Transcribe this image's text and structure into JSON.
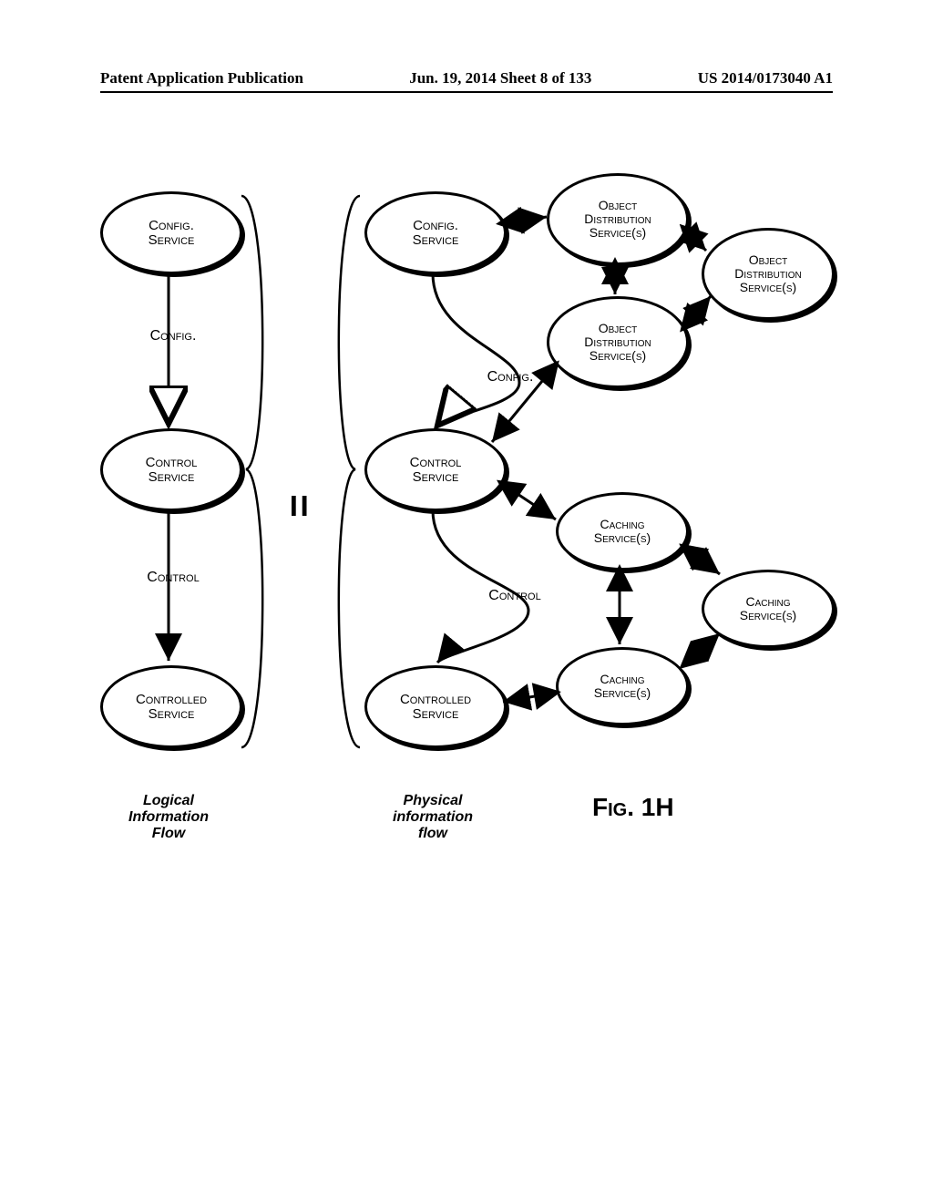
{
  "header": {
    "left": "Patent Application Publication",
    "center": "Jun. 19, 2014  Sheet 8 of 133",
    "right": "US 2014/0173040 A1"
  },
  "nodes": {
    "logical": {
      "config": {
        "l1": "Config.",
        "l2": "Service"
      },
      "control": {
        "l1": "Control",
        "l2": "Service"
      },
      "controlled": {
        "l1": "Controlled",
        "l2": "Service"
      }
    },
    "physical": {
      "config": {
        "l1": "Config.",
        "l2": "Service"
      },
      "control": {
        "l1": "Control",
        "l2": "Service"
      },
      "controlled": {
        "l1": "Controlled",
        "l2": "Service"
      },
      "od_top": {
        "l1": "Object",
        "l2": "Distribution",
        "l3": "Service(s)"
      },
      "od_mid": {
        "l1": "Object",
        "l2": "Distribution",
        "l3": "Service(s)"
      },
      "od_right": {
        "l1": "Object",
        "l2": "Distribution",
        "l3": "Service(s)"
      },
      "cache_top": {
        "l1": "Caching",
        "l2": "Service(s)"
      },
      "cache_bot": {
        "l1": "Caching",
        "l2": "Service(s)"
      },
      "cache_right": {
        "l1": "Caching",
        "l2": "Service(s)"
      }
    }
  },
  "labels": {
    "config_l": "Config.",
    "control_l": "Control",
    "config_p": "Config.",
    "control_p": "Control"
  },
  "captions": {
    "logical": "Logical\nInformation\nFlow",
    "physical": "Physical\ninformation\nflow"
  },
  "equals": "=",
  "figure_label": "Fig. 1H",
  "chart_data": {
    "type": "diagram",
    "title": "FIG. 1H — Logical vs. Physical information flow",
    "sides": [
      {
        "name": "Logical Information Flow",
        "nodes": [
          "Config. Service",
          "Control Service",
          "Controlled Service"
        ],
        "edges": [
          {
            "from": "Config. Service",
            "to": "Control Service",
            "label": "Config.",
            "style": "hollow-arrow"
          },
          {
            "from": "Control Service",
            "to": "Controlled Service",
            "label": "Control",
            "style": "solid-arrow"
          }
        ]
      },
      {
        "name": "Physical information flow",
        "nodes": [
          "Config. Service",
          "Control Service",
          "Controlled Service",
          "Object Distribution Service(s) (top)",
          "Object Distribution Service(s) (mid)",
          "Object Distribution Service(s) (right)",
          "Caching Service(s) (top)",
          "Caching Service(s) (bottom)",
          "Caching Service(s) (right)"
        ],
        "edges": [
          {
            "from": "Config. Service",
            "to": "Control Service",
            "label": "Config.",
            "via": "Object Distribution / Caching cluster",
            "style": "hollow-arrow, curved"
          },
          {
            "from": "Control Service",
            "to": "Controlled Service",
            "label": "Control",
            "via": "Object Distribution / Caching cluster",
            "style": "solid-arrow, curved"
          },
          {
            "from": "Config. Service",
            "to": "Object Distribution Service(s) (top)",
            "style": "double-arrow"
          },
          {
            "from": "Object Distribution Service(s) (top)",
            "to": "Object Distribution Service(s) (mid)",
            "style": "double-arrow"
          },
          {
            "from": "Object Distribution Service(s) (top)",
            "to": "Object Distribution Service(s) (right)",
            "style": "double-arrow"
          },
          {
            "from": "Object Distribution Service(s) (mid)",
            "to": "Object Distribution Service(s) (right)",
            "style": "double-arrow"
          },
          {
            "from": "Object Distribution Service(s) (mid)",
            "to": "Control Service",
            "style": "double-arrow"
          },
          {
            "from": "Control Service",
            "to": "Caching Service(s) (top)",
            "style": "double-arrow"
          },
          {
            "from": "Caching Service(s) (top)",
            "to": "Caching Service(s) (bottom)",
            "style": "double-arrow"
          },
          {
            "from": "Caching Service(s) (top)",
            "to": "Caching Service(s) (right)",
            "style": "double-arrow"
          },
          {
            "from": "Caching Service(s) (bottom)",
            "to": "Caching Service(s) (right)",
            "style": "double-arrow"
          },
          {
            "from": "Caching Service(s) (bottom)",
            "to": "Controlled Service",
            "style": "double-arrow"
          }
        ]
      }
    ],
    "relation_between_sides": "equals"
  }
}
